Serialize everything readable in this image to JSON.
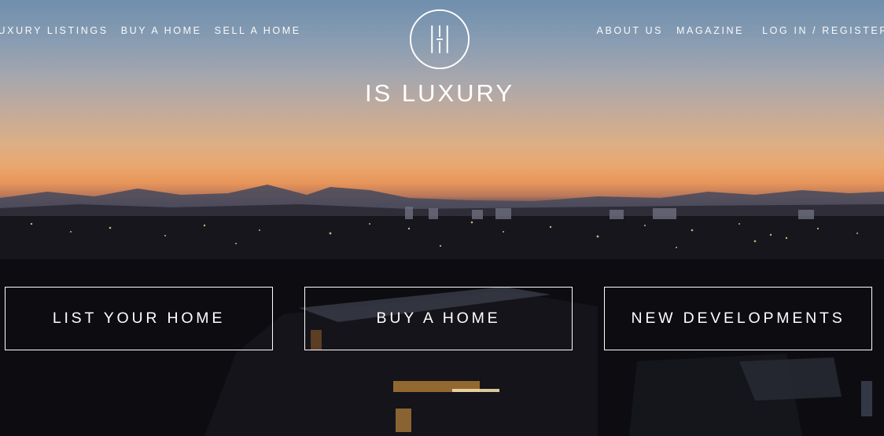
{
  "nav": {
    "left": [
      "LUXURY LISTINGS",
      "BUY A HOME",
      "SELL A HOME"
    ],
    "right": [
      "ABOUT US",
      "MAGAZINE",
      "LOG IN / REGISTER"
    ]
  },
  "brand": {
    "name": "IS LUXURY",
    "logo_icon": "is-monogram-circle-icon"
  },
  "cta": [
    {
      "label": "LIST YOUR HOME"
    },
    {
      "label": "BUY A HOME"
    },
    {
      "label": "NEW DEVELOPMENTS"
    }
  ],
  "colors": {
    "text": "#ffffff",
    "sky_top": "#6f8fae",
    "sunset": "#e9a86f",
    "night": "#0c0c10"
  }
}
